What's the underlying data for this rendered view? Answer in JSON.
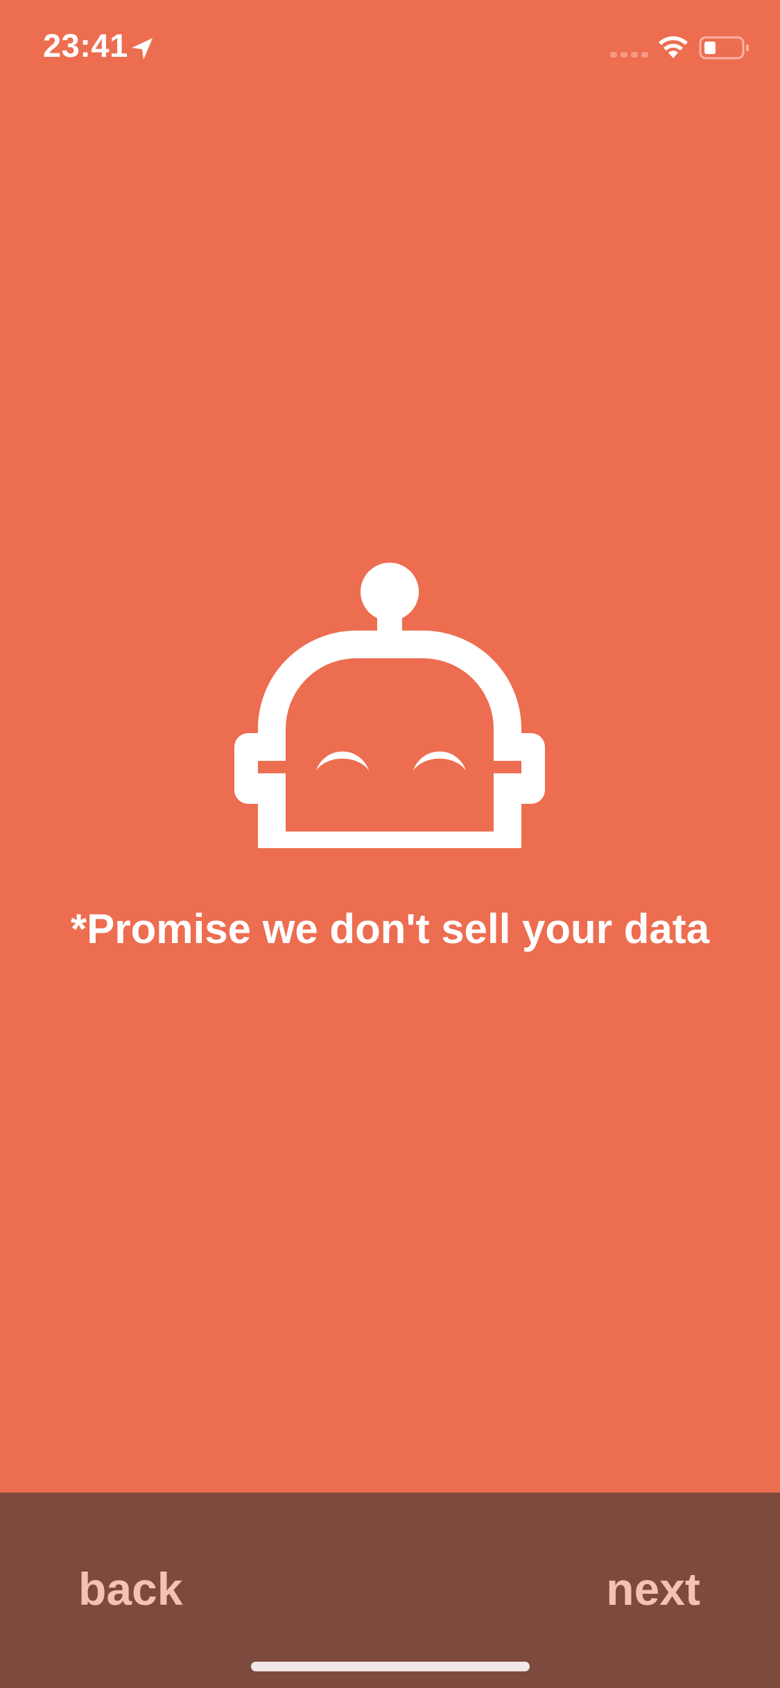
{
  "status_bar": {
    "time": "23:41",
    "icons": [
      "location-arrow-icon",
      "cellular-signal-icon",
      "wifi-icon",
      "battery-icon"
    ]
  },
  "main": {
    "illustration_icon": "robot-icon",
    "headline": "*Promise we don't sell your data"
  },
  "navigation": {
    "back_label": "back",
    "next_label": "next"
  },
  "colors": {
    "background": "#ED6D50",
    "bottom_bar": "#7E4A3E",
    "nav_text": "#F5C2B2",
    "text": "#FFFFFF"
  }
}
